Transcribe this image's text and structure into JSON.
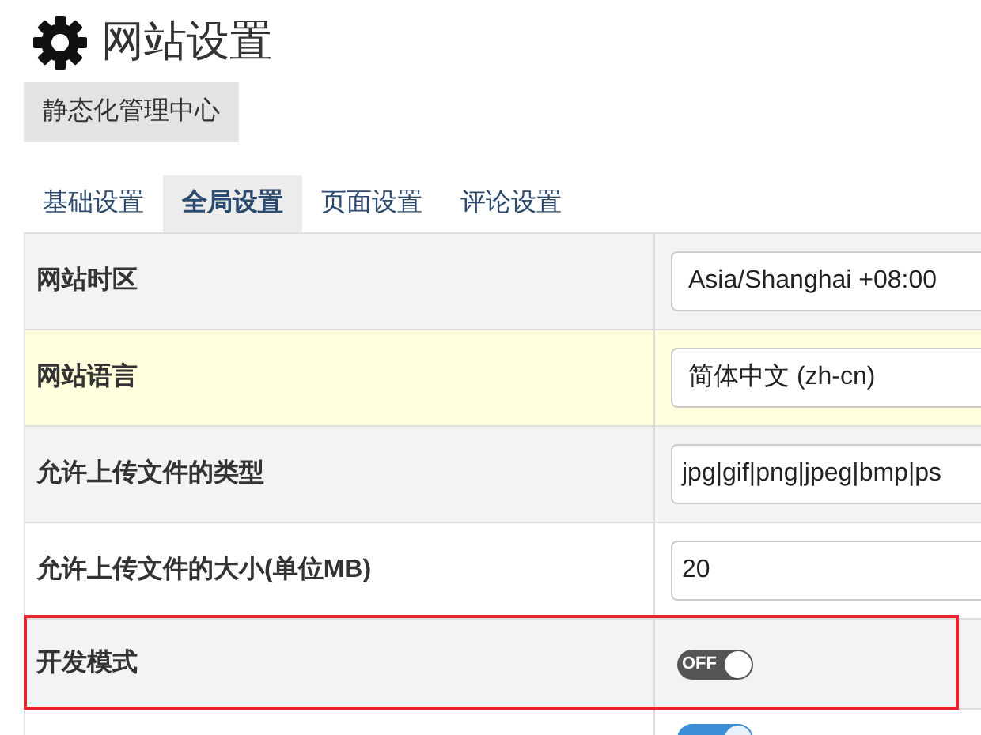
{
  "page": {
    "title": "网站设置"
  },
  "static_button": "静态化管理中心",
  "tabs": [
    {
      "label": "基础设置",
      "selected": false
    },
    {
      "label": "全局设置",
      "selected": true
    },
    {
      "label": "页面设置",
      "selected": false
    },
    {
      "label": "评论设置",
      "selected": false
    }
  ],
  "rows": [
    {
      "label": "网站时区",
      "kind": "select",
      "value": "Asia/Shanghai +08:00",
      "highlighted": false,
      "outlined": false
    },
    {
      "label": "网站语言",
      "kind": "select",
      "value": "简体中文 (zh-cn)",
      "highlighted": true,
      "outlined": false
    },
    {
      "label": "允许上传文件的类型",
      "kind": "input",
      "value": "jpg|gif|png|jpeg|bmp|ps",
      "highlighted": false,
      "outlined": false
    },
    {
      "label": "允许上传文件的大小(单位MB)",
      "kind": "input",
      "value": "20",
      "highlighted": false,
      "outlined": false
    },
    {
      "label": "开发模式",
      "kind": "toggle",
      "on": false,
      "toggle_text": "OFF",
      "highlighted": false,
      "outlined": true
    },
    {
      "kind": "toggle",
      "on": true,
      "highlighted": false,
      "outlined": false
    }
  ]
}
